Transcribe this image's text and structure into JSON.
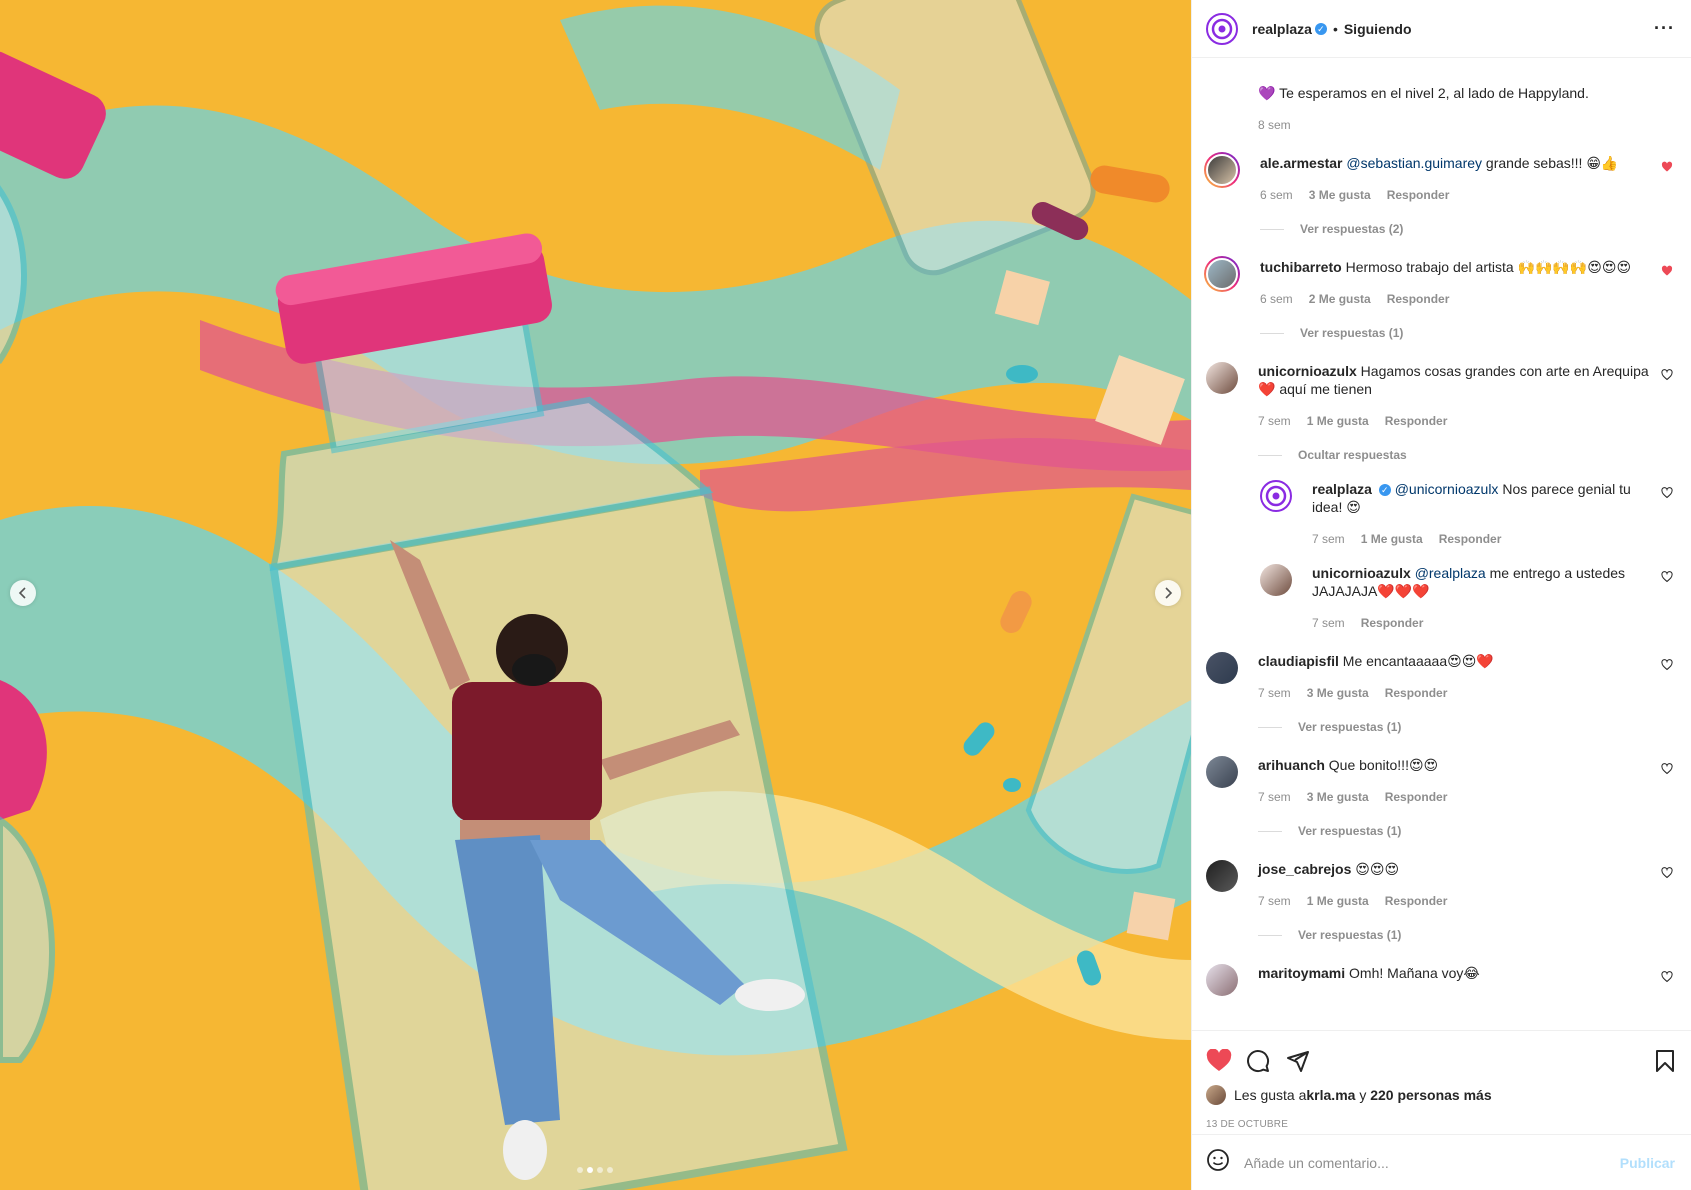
{
  "post": {
    "author": "realplaza",
    "separator": "•",
    "follow_status": "Siguiendo",
    "caption_text": "Te esperamos en el nivel 2, al lado de Happyland.",
    "caption_time": "8 sem"
  },
  "labels": {
    "reply": "Responder",
    "hide_replies": "Ocultar respuestas"
  },
  "comments": [
    {
      "user": "ale.armestar",
      "mention": "@sebastian.guimarey",
      "text": " grande sebas!!! 😁👍",
      "time": "6 sem",
      "likes": "3 Me gusta",
      "replies": "Ver respuestas (2)",
      "liked": true
    },
    {
      "user": "tuchibarreto",
      "mention": "",
      "text": " Hermoso trabajo del artista 🙌🙌🙌🙌😍😍😍",
      "time": "6 sem",
      "likes": "2 Me gusta",
      "replies": "Ver respuestas (1)",
      "liked": true
    },
    {
      "user": "unicornioazulx",
      "mention": "",
      "text": " Hagamos cosas grandes con arte en Arequipa ❤️ aquí me tienen",
      "time": "7 sem",
      "likes": "1 Me gusta",
      "liked": false
    },
    {
      "user": "claudiapisfil",
      "mention": "",
      "text": " Me encantaaaaa😍😍❤️",
      "time": "7 sem",
      "likes": "3 Me gusta",
      "replies": "Ver respuestas (1)",
      "liked": false
    },
    {
      "user": "arihuanch",
      "mention": "",
      "text": " Que bonito!!!😍😍",
      "time": "7 sem",
      "likes": "3 Me gusta",
      "replies": "Ver respuestas (1)",
      "liked": false
    },
    {
      "user": "jose_cabrejos",
      "mention": "",
      "text": " 😍😍😍",
      "time": "7 sem",
      "likes": "1 Me gusta",
      "replies": "Ver respuestas (1)",
      "liked": false
    },
    {
      "user": "maritoymami",
      "mention": "",
      "text": " Omh! Mañana voy😂",
      "liked": false
    }
  ],
  "nested_replies": [
    {
      "user": "realplaza",
      "mention": "@unicornioazulx",
      "text": " Nos parece genial tu idea! 😍",
      "time": "7 sem",
      "likes": "1 Me gusta"
    },
    {
      "user": "unicornioazulx",
      "mention": "@realplaza",
      "text": " me entrego a ustedes JAJAJAJA❤️❤️❤️",
      "time": "7 sem"
    }
  ],
  "footer": {
    "likes_prefix": "Les gusta a ",
    "likes_user": "krla.ma",
    "likes_mid": " y ",
    "likes_rest": "220 personas más",
    "date": "13 de octubre",
    "comment_placeholder": "Añade un comentario...",
    "publish": "Publicar"
  },
  "colors": {
    "heart_liked": "#ed4956",
    "link": "#00376b",
    "verified": "#3897f0",
    "publish_disabled": "#b2dffc"
  },
  "carousel": {
    "slides": 4,
    "active": 2
  }
}
